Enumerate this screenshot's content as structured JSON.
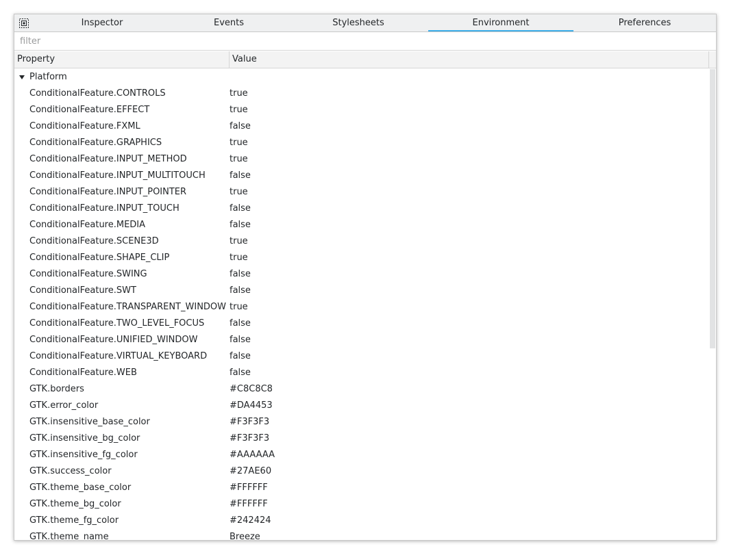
{
  "tabs": [
    {
      "label": "Inspector",
      "active": false
    },
    {
      "label": "Events",
      "active": false
    },
    {
      "label": "Stylesheets",
      "active": false
    },
    {
      "label": "Environment",
      "active": true
    },
    {
      "label": "Preferences",
      "active": false
    }
  ],
  "filter": {
    "placeholder": "filter",
    "value": ""
  },
  "columns": {
    "property": "Property",
    "value": "Value"
  },
  "group": {
    "label": "Platform",
    "expanded": true
  },
  "rows": [
    {
      "key": "ConditionalFeature.CONTROLS",
      "value": "true"
    },
    {
      "key": "ConditionalFeature.EFFECT",
      "value": "true"
    },
    {
      "key": "ConditionalFeature.FXML",
      "value": "false"
    },
    {
      "key": "ConditionalFeature.GRAPHICS",
      "value": "true"
    },
    {
      "key": "ConditionalFeature.INPUT_METHOD",
      "value": "true"
    },
    {
      "key": "ConditionalFeature.INPUT_MULTITOUCH",
      "value": "false"
    },
    {
      "key": "ConditionalFeature.INPUT_POINTER",
      "value": "true"
    },
    {
      "key": "ConditionalFeature.INPUT_TOUCH",
      "value": "false"
    },
    {
      "key": "ConditionalFeature.MEDIA",
      "value": "false"
    },
    {
      "key": "ConditionalFeature.SCENE3D",
      "value": "true"
    },
    {
      "key": "ConditionalFeature.SHAPE_CLIP",
      "value": "true"
    },
    {
      "key": "ConditionalFeature.SWING",
      "value": "false"
    },
    {
      "key": "ConditionalFeature.SWT",
      "value": "false"
    },
    {
      "key": "ConditionalFeature.TRANSPARENT_WINDOW",
      "value": "true"
    },
    {
      "key": "ConditionalFeature.TWO_LEVEL_FOCUS",
      "value": "false"
    },
    {
      "key": "ConditionalFeature.UNIFIED_WINDOW",
      "value": "false"
    },
    {
      "key": "ConditionalFeature.VIRTUAL_KEYBOARD",
      "value": "false"
    },
    {
      "key": "ConditionalFeature.WEB",
      "value": "false"
    },
    {
      "key": "GTK.borders",
      "value": "#C8C8C8"
    },
    {
      "key": "GTK.error_color",
      "value": "#DA4453"
    },
    {
      "key": "GTK.insensitive_base_color",
      "value": "#F3F3F3"
    },
    {
      "key": "GTK.insensitive_bg_color",
      "value": "#F3F3F3"
    },
    {
      "key": "GTK.insensitive_fg_color",
      "value": "#AAAAAA"
    },
    {
      "key": "GTK.success_color",
      "value": "#27AE60"
    },
    {
      "key": "GTK.theme_base_color",
      "value": "#FFFFFF"
    },
    {
      "key": "GTK.theme_bg_color",
      "value": "#FFFFFF"
    },
    {
      "key": "GTK.theme_fg_color",
      "value": "#242424"
    },
    {
      "key": "GTK.theme_name",
      "value": "Breeze"
    }
  ],
  "colors": {
    "accent": "#3daee9",
    "border": "#c8c8c8",
    "tabbar_bg": "#eff0f1",
    "header_bg": "#f3f3f3",
    "text": "#232629"
  },
  "icons": {
    "pick": "element-picker-icon",
    "expand": "triangle-down-icon"
  }
}
